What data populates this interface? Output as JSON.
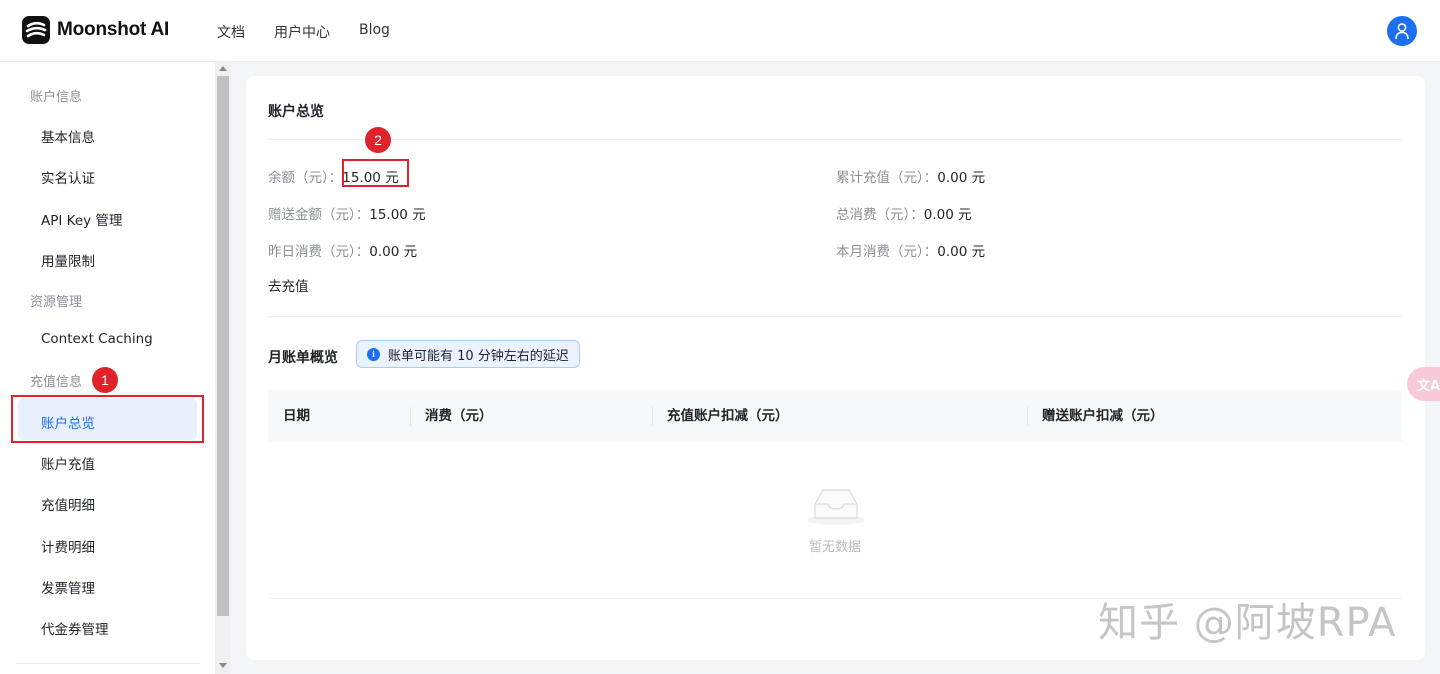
{
  "header": {
    "brand": "Moonshot AI",
    "nav": [
      "文档",
      "用户中心",
      "Blog"
    ]
  },
  "sidebar": {
    "groups": [
      {
        "title": "账户信息",
        "items": [
          "基本信息",
          "实名认证",
          "API Key 管理",
          "用量限制"
        ]
      },
      {
        "title": "资源管理",
        "items": [
          "Context Caching"
        ]
      },
      {
        "title": "充值信息",
        "items": [
          "账户总览",
          "账户充值",
          "充值明细",
          "计费明细",
          "发票管理",
          "代金券管理"
        ]
      }
    ],
    "active_item": "账户总览"
  },
  "annotations": [
    "1",
    "2"
  ],
  "overview": {
    "title": "账户总览",
    "left": [
      {
        "label": "余额（元）：",
        "value": "15.00 元"
      },
      {
        "label": "赠送金额（元）：",
        "value": "15.00 元"
      },
      {
        "label": "昨日消费（元）：",
        "value": "0.00 元"
      }
    ],
    "right": [
      {
        "label": "累计充值（元）：",
        "value": "0.00 元"
      },
      {
        "label": "总消费（元）：",
        "value": "0.00 元"
      },
      {
        "label": "本月消费（元）：",
        "value": "0.00 元"
      }
    ],
    "recharge_link": "去充值"
  },
  "bills": {
    "title": "月账单概览",
    "notice": "账单可能有 10 分钟左右的延迟",
    "columns": [
      "日期",
      "消费（元）",
      "充值账户扣减（元）",
      "赠送账户扣减（元）"
    ],
    "empty_text": "暂无数据"
  },
  "translate_label": "文A",
  "watermark": "知乎 @阿坡RPA",
  "colors": {
    "accent": "#1d6ff2",
    "annotation": "#e0222a"
  }
}
